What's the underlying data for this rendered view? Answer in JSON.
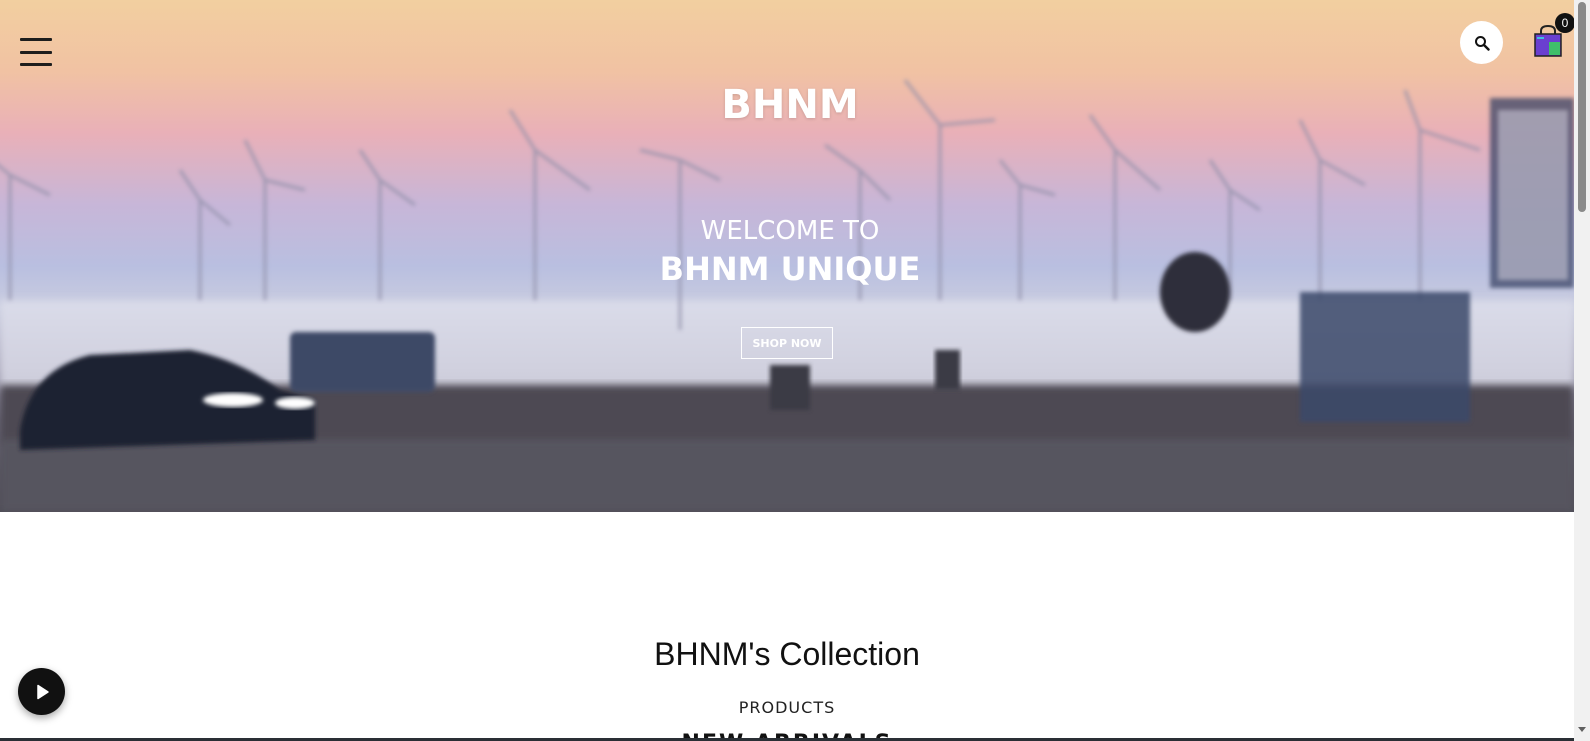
{
  "header": {
    "menu_icon": "hamburger-menu-icon",
    "search_icon": "search-icon",
    "cart_icon": "shopping-bag-icon",
    "cart_count": "0"
  },
  "hero": {
    "brand": "BHNM",
    "welcome_line1": "WELCOME TO",
    "welcome_line2": "BHNM UNIQUE",
    "cta_label": "SHOP NOW"
  },
  "collection": {
    "title": "BHNM's Collection",
    "subtitle": "PRODUCTS",
    "section_heading": "NEW ARRIVALS"
  },
  "media": {
    "play_icon": "play-icon"
  },
  "colors": {
    "hero_text": "#ffffff",
    "button_dark": "#111111",
    "cart_purple": "#6a3fd0",
    "cart_green": "#3fbf6a"
  }
}
